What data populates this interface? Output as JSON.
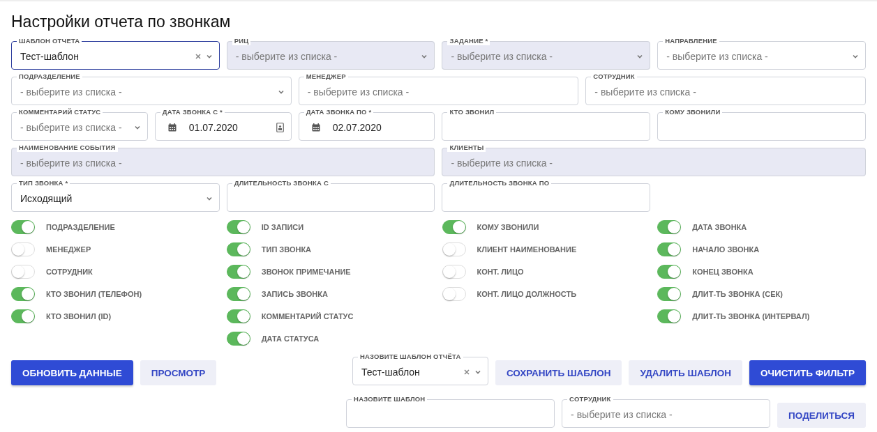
{
  "title": "Настройки отчета по звонкам",
  "filter_rows": [
    [
      {
        "label": "ШАБЛОН ОТЧЕТА",
        "kind": "select",
        "value": "Тест-шаблон",
        "clearable": true,
        "disabled": false,
        "focused": true
      },
      {
        "label": "РИЦ",
        "kind": "select",
        "placeholder": "- выберите из списка -",
        "clearable": false,
        "disabled": true,
        "focused": false
      },
      {
        "label": "ЗАДАНИЕ *",
        "kind": "select",
        "placeholder": "- выберите из списка -",
        "clearable": false,
        "disabled": true,
        "focused": false
      },
      {
        "label": "НАПРАВЛЕНИЕ",
        "kind": "select",
        "placeholder": "- выберите из списка -",
        "clearable": false,
        "disabled": false,
        "focused": false
      }
    ],
    [
      {
        "label": "ПОДРАЗДЕЛЕНИЕ",
        "kind": "select",
        "placeholder": "- выберите из списка -",
        "clearable": false,
        "disabled": false,
        "focused": false
      },
      {
        "label": "МЕНЕДЖЕР",
        "kind": "search",
        "placeholder": "- выберите из списка -",
        "disabled": false,
        "focused": false
      },
      {
        "label": "СОТРУДНИК",
        "kind": "search",
        "placeholder": "- выберите из списка -",
        "disabled": false,
        "focused": false
      }
    ],
    [
      {
        "label": "КОММЕНТАРИЙ СТАТУС",
        "kind": "select",
        "placeholder": "- выберите из списка -",
        "clearable": false,
        "disabled": false,
        "focused": false
      },
      {
        "label": "ДАТА ЗВОНКА С *",
        "kind": "date",
        "value": "01.07.2020",
        "trailing_icon": true,
        "disabled": false,
        "focused": false
      },
      {
        "label": "ДАТА ЗВОНКА ПО *",
        "kind": "date",
        "value": "02.07.2020",
        "trailing_icon": false,
        "disabled": false,
        "focused": false
      },
      {
        "label": "КТО ЗВОНИЛ",
        "kind": "text",
        "disabled": false,
        "focused": false
      },
      {
        "label": "КОМУ ЗВОНИЛИ",
        "kind": "text",
        "disabled": false,
        "focused": false
      }
    ],
    [
      {
        "label": "НАИМЕНОВАНИЕ СОБЫТИЯ",
        "kind": "search",
        "placeholder": "- выберите из списка -",
        "disabled": true,
        "focused": false
      },
      {
        "label": "КЛИЕНТЫ",
        "kind": "search",
        "placeholder": "- выберите из списка -",
        "disabled": true,
        "focused": false
      }
    ],
    [
      {
        "label": "ТИП ЗВОНКА *",
        "kind": "select",
        "value": "Исходящий",
        "clearable": false,
        "disabled": false,
        "focused": false
      },
      {
        "label": "ДЛИТЕЛЬНОСТЬ ЗВОНКА С",
        "kind": "text",
        "disabled": false,
        "focused": false
      },
      {
        "label": "ДЛИТЕЛЬНОСТЬ ЗВОНКА ПО",
        "kind": "text",
        "disabled": false,
        "focused": false
      }
    ]
  ],
  "toggle_columns": [
    [
      {
        "label": "ПОДРАЗДЕЛЕНИЕ",
        "on": true
      },
      {
        "label": "МЕНЕДЖЕР",
        "on": false
      },
      {
        "label": "СОТРУДНИК",
        "on": false
      },
      {
        "label": "КТО ЗВОНИЛ (ТЕЛЕФОН)",
        "on": true
      },
      {
        "label": "КТО ЗВОНИЛ (ID)",
        "on": true
      }
    ],
    [
      {
        "label": "ID ЗАПИСИ",
        "on": true
      },
      {
        "label": "ТИП ЗВОНКА",
        "on": true
      },
      {
        "label": "ЗВОНОК ПРИМЕЧАНИЕ",
        "on": true
      },
      {
        "label": "ЗАПИСЬ ЗВОНКА",
        "on": true
      },
      {
        "label": "КОММЕНТАРИЙ СТАТУС",
        "on": true
      },
      {
        "label": "ДАТА СТАТУСА",
        "on": true
      }
    ],
    [
      {
        "label": "КОМУ ЗВОНИЛИ",
        "on": true
      },
      {
        "label": "КЛИЕНТ НАИМЕНОВАНИЕ",
        "on": false
      },
      {
        "label": "КОНТ. ЛИЦО",
        "on": false
      },
      {
        "label": "КОНТ. ЛИЦО ДОЛЖНОСТЬ",
        "on": false
      }
    ],
    [
      {
        "label": "ДАТА ЗВОНКА",
        "on": true
      },
      {
        "label": "НАЧАЛО ЗВОНКА",
        "on": true
      },
      {
        "label": "КОНЕЦ ЗВОНКА",
        "on": true
      },
      {
        "label": "ДЛИТ-ТЬ ЗВОНКА (СЕК)",
        "on": true
      },
      {
        "label": "ДЛИТ-ТЬ ЗВОНКА (ИНТЕРВАЛ)",
        "on": true
      }
    ]
  ],
  "actions_left": [
    {
      "label": "ОБНОВИТЬ ДАННЫЕ",
      "kind": "primary"
    },
    {
      "label": "ПРОСМОТР",
      "kind": "secondary"
    }
  ],
  "template_select": {
    "label": "НАЗОВИТЕ ШАБЛОН ОТЧЁТА",
    "kind": "select",
    "value": "Тест-шаблон",
    "clearable": true,
    "disabled": false,
    "focused": false
  },
  "actions_right": [
    {
      "label": "СОХРАНИТЬ ШАБЛОН",
      "kind": "secondary"
    },
    {
      "label": "УДАЛИТЬ ШАБЛОН",
      "kind": "secondary"
    },
    {
      "label": "ОЧИСТИТЬ ФИЛЬТР",
      "kind": "primary"
    }
  ],
  "share_fields": [
    {
      "label": "НАЗОВИТЕ ШАБЛОН",
      "disabled": false,
      "focused": false
    },
    {
      "label": "СОТРУДНИК",
      "placeholder": "- выберите из списка -",
      "disabled": false,
      "focused": false
    }
  ],
  "share_button": {
    "label": "ПОДЕЛИТЬСЯ",
    "kind": "secondary"
  }
}
